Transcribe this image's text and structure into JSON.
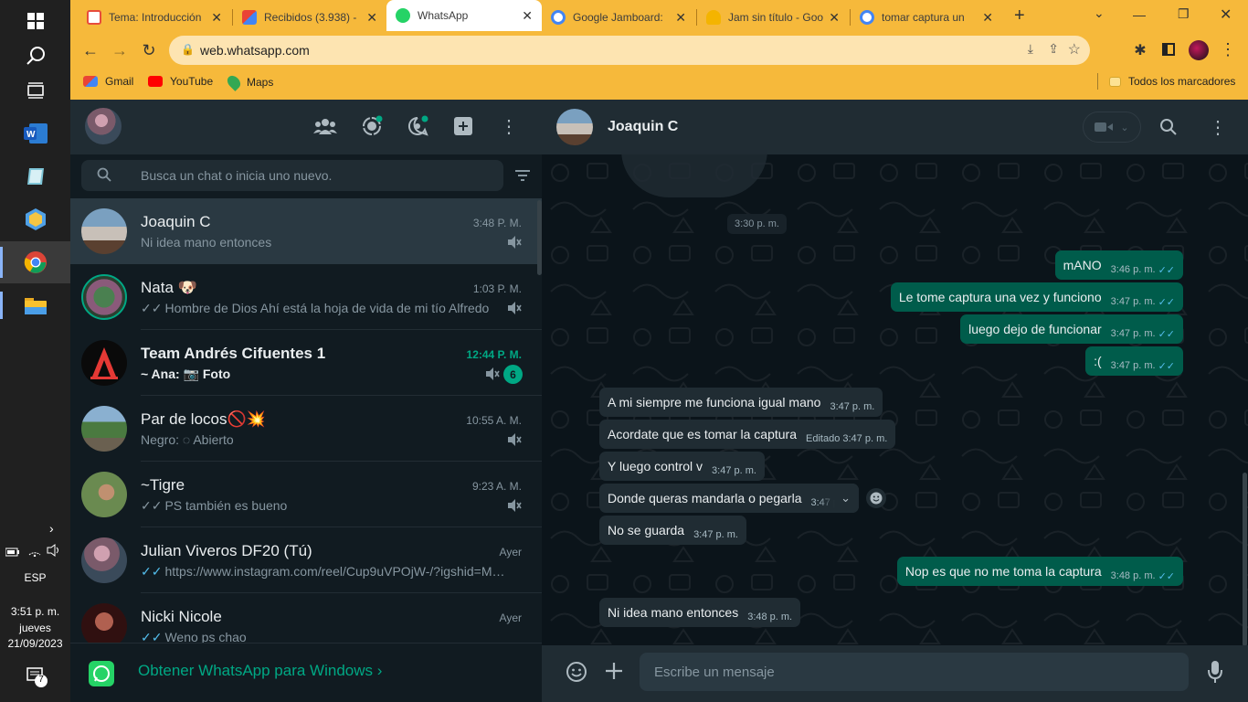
{
  "taskbar": {
    "language": "ESP",
    "time": "3:51 p. m.",
    "day": "jueves",
    "date": "21/09/2023",
    "notifications": "7"
  },
  "browser": {
    "tabs": [
      {
        "title": "Tema: Introducción",
        "icon": "moodle-icon",
        "color": "#e74c3c"
      },
      {
        "title": "Recibidos (3.938) -",
        "icon": "gmail-icon",
        "color": "#ea4335"
      },
      {
        "title": "WhatsApp",
        "icon": "whatsapp-icon",
        "color": "#25d366",
        "active": true
      },
      {
        "title": "Google Jamboard:",
        "icon": "google-icon",
        "color": "#4285f4"
      },
      {
        "title": "Jam sin título - Goo",
        "icon": "jamboard-icon",
        "color": "#f4b400"
      },
      {
        "title": "tomar captura un",
        "icon": "google-icon",
        "color": "#4285f4"
      }
    ],
    "url": "web.whatsapp.com",
    "bookmarks": [
      "Gmail",
      "YouTube",
      "Maps"
    ],
    "all_bookmarks": "Todos los marcadores"
  },
  "sidebar": {
    "search_placeholder": "Busca un chat o inicia uno nuevo.",
    "chats": [
      {
        "name": "Joaquin C",
        "preview": "Ni idea mano entonces",
        "time": "3:48 P. M.",
        "muted": true
      },
      {
        "name": "Nata 🐶",
        "preview": "Hombre de Dios  Ahí está la hoja de vida de mi tío Alfredo",
        "time": "1:03 P. M.",
        "ticks": "✓✓",
        "muted": true
      },
      {
        "name": "Team Andrés Cifuentes 1",
        "preview": "~ Ana: 📷 Foto",
        "time": "12:44 P. M.",
        "muted": true,
        "unread": "6"
      },
      {
        "name": "Par de locos🚫💥",
        "preview": "Negro: ◌ Abierto",
        "time": "10:55 A. M.",
        "muted": true
      },
      {
        "name": "~Tigre",
        "preview": "PS también es bueno",
        "time": "9:23 A. M.",
        "ticks": "✓✓",
        "muted": true
      },
      {
        "name": "Julian Viveros DF20 (Tú)",
        "preview": "https://www.instagram.com/reel/Cup9uVPOjW-/?igshid=MTc...",
        "time": "Ayer",
        "ticks": "✓✓"
      },
      {
        "name": "Nicki Nicole",
        "preview": "Weno ps chao",
        "time": "Ayer",
        "ticks": "✓✓"
      }
    ],
    "footer": "Obtener WhatsApp para Windows ›"
  },
  "conversation": {
    "contact": "Joaquin C",
    "date_pill": "3:30 p. m.",
    "messages": [
      {
        "dir": "out",
        "text": "mANO",
        "time": "3:46 p. m."
      },
      {
        "dir": "out",
        "text": "Le tome captura una vez y funciono",
        "time": "3:47 p. m."
      },
      {
        "dir": "out",
        "text": "luego dejo de funcionar",
        "time": "3:47 p. m."
      },
      {
        "dir": "out",
        "text": ":(",
        "time": "3:47 p. m."
      },
      {
        "dir": "in",
        "text": "A mi siempre me funciona igual mano",
        "time": "3:47 p. m."
      },
      {
        "dir": "in",
        "text": "Acordate que es tomar la captura",
        "time": "Editado 3:47 p. m."
      },
      {
        "dir": "in",
        "text": "Y luego control v",
        "time": "3:47 p. m."
      },
      {
        "dir": "in",
        "text": "Donde queras mandarla o pegarla",
        "time": "3:47 p"
      },
      {
        "dir": "in",
        "text": "No se guarda",
        "time": "3:47 p. m."
      },
      {
        "dir": "out",
        "text": "Nop es que no me toma la captura",
        "time": "3:48 p. m."
      },
      {
        "dir": "in",
        "text": "Ni idea mano entonces",
        "time": "3:48 p. m."
      }
    ],
    "input_placeholder": "Escribe un mensaje"
  }
}
